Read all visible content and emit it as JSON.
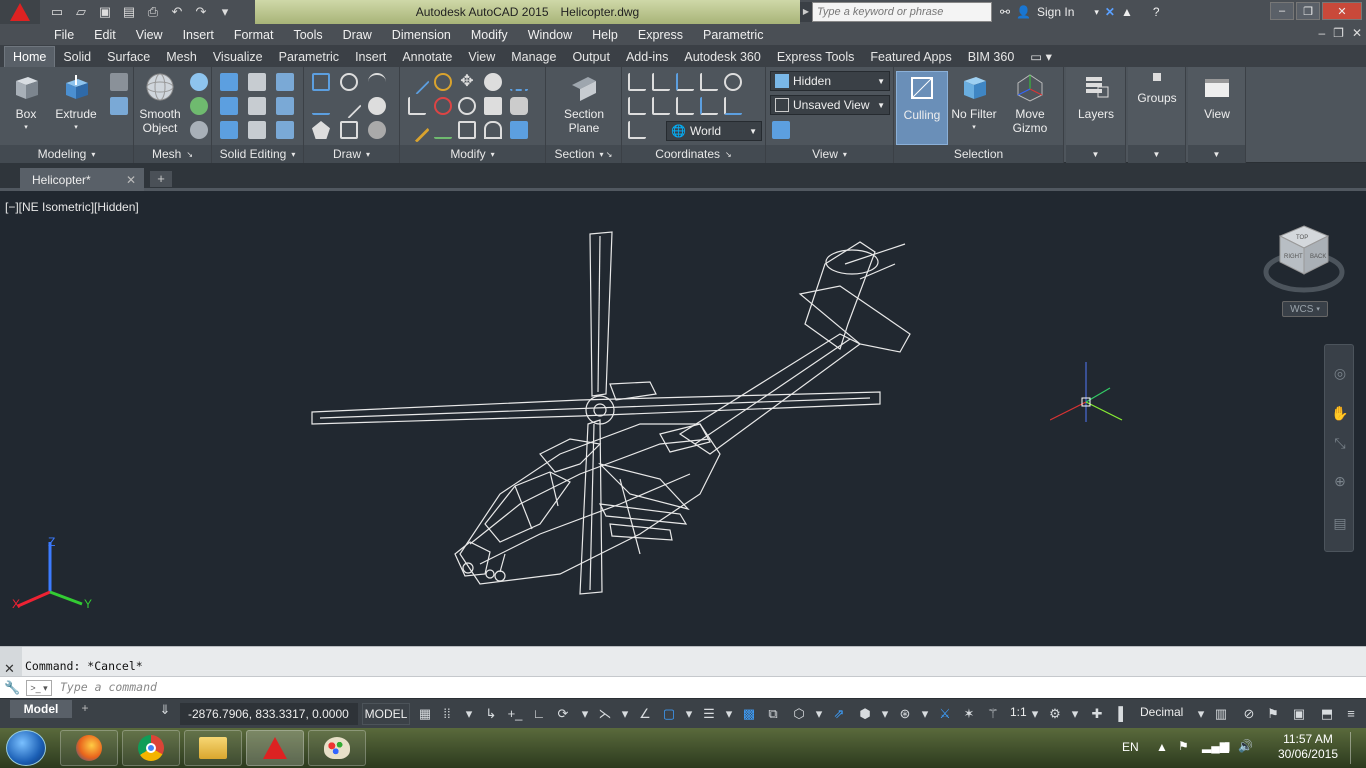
{
  "window": {
    "app_name": "Autodesk AutoCAD 2015",
    "file_name": "Helicopter.dwg",
    "search_placeholder": "Type a keyword or phrase",
    "sign_in": "Sign In"
  },
  "menu": [
    "File",
    "Edit",
    "View",
    "Insert",
    "Format",
    "Tools",
    "Draw",
    "Dimension",
    "Modify",
    "Window",
    "Help",
    "Express",
    "Parametric"
  ],
  "ribbon_tabs": [
    "Home",
    "Solid",
    "Surface",
    "Mesh",
    "Visualize",
    "Parametric",
    "Insert",
    "Annotate",
    "View",
    "Manage",
    "Output",
    "Add-ins",
    "Autodesk 360",
    "Express Tools",
    "Featured Apps",
    "BIM 360"
  ],
  "ribbon": {
    "box": "Box",
    "extrude": "Extrude",
    "smooth_object_1": "Smooth",
    "smooth_object_2": "Object",
    "section_plane_1": "Section",
    "section_plane_2": "Plane",
    "visual_style": "Hidden",
    "named_view": "Unsaved View",
    "ucs": "World",
    "culling": "Culling",
    "no_filter": "No Filter",
    "move_gizmo_1": "Move",
    "move_gizmo_2": "Gizmo",
    "layers": "Layers",
    "groups": "Groups",
    "view": "View",
    "panels": {
      "modeling": "Modeling",
      "mesh": "Mesh",
      "solid_editing": "Solid Editing",
      "draw": "Draw",
      "modify": "Modify",
      "section": "Section",
      "coordinates": "Coordinates",
      "view": "View",
      "selection": "Selection"
    }
  },
  "file_tab": "Helicopter*",
  "viewport_label": "[−][NE Isometric][Hidden]",
  "wcs_label": "WCS",
  "viewcube_faces": {
    "top": "TOP",
    "right": "RIGHT",
    "back": "BACK"
  },
  "ucs_axes": {
    "x": "X",
    "y": "Y",
    "z": "Z"
  },
  "command": {
    "history": "Command: *Cancel*",
    "placeholder": "Type a command"
  },
  "status": {
    "layout_tab": "Model",
    "coordinates": "-2876.7906, 833.3317, 0.0000",
    "space": "MODEL",
    "annotation_scale": "1:1",
    "units": "Decimal"
  },
  "taskbar": {
    "language": "EN",
    "time": "11:57 AM",
    "date": "30/06/2015"
  },
  "colors": {
    "viewport_bg": "#212830",
    "ribbon_bg": "#4e555c",
    "accent_blue": "#3da0ff",
    "wireframe": "#e8e8e8"
  }
}
